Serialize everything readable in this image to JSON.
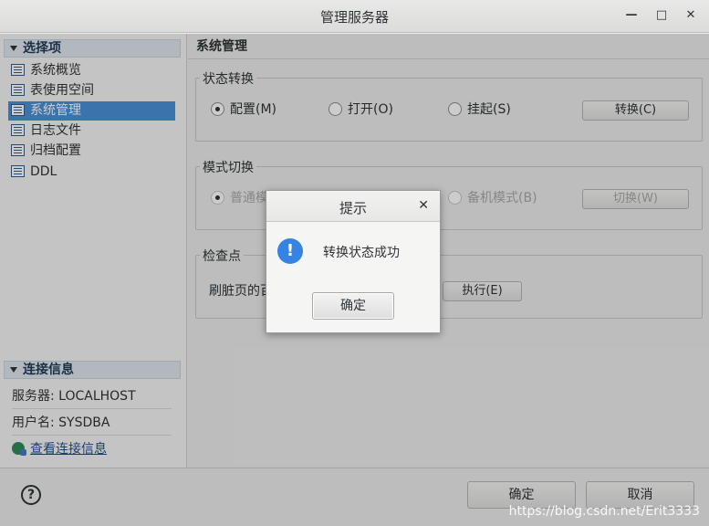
{
  "window": {
    "title": "管理服务器",
    "minimize_glyph": "—",
    "maximize_glyph": "□",
    "close_glyph": "✕"
  },
  "sidebar": {
    "section_title": "选择项",
    "items": [
      {
        "label": "系统概览",
        "selected": false
      },
      {
        "label": "表使用空间",
        "selected": false
      },
      {
        "label": "系统管理",
        "selected": true
      },
      {
        "label": "日志文件",
        "selected": false
      },
      {
        "label": "归档配置",
        "selected": false
      },
      {
        "label": "DDL",
        "selected": false
      }
    ],
    "connection_title": "连接信息",
    "server_row": "服务器: LOCALHOST",
    "user_row": "用户名: SYSDBA",
    "view_link": "查看连接信息"
  },
  "main": {
    "title": "系统管理",
    "state_group": {
      "label": "状态转换",
      "radio_config": "配置(M)",
      "radio_open": "打开(O)",
      "radio_mount": "挂起(S)",
      "button": "转换(C)"
    },
    "mode_group": {
      "label": "模式切换",
      "radio_normal": "普通模式(N)",
      "radio_standby": "备机模式(B)",
      "button": "切换(W)"
    },
    "checkpoint_group": {
      "label": "检查点",
      "dirty_label": "刷脏页的百分比",
      "button": "执行(E)"
    }
  },
  "footer": {
    "help_glyph": "?",
    "ok": "确定",
    "cancel": "取消"
  },
  "dialog": {
    "title": "提示",
    "close_glyph": "✕",
    "icon_glyph": "!",
    "message": "转换状态成功",
    "ok": "确定"
  },
  "watermark": "https://blog.csdn.net/Erit3333",
  "colors": {
    "selection": "#4a90d9",
    "info_icon": "#3584e4"
  }
}
